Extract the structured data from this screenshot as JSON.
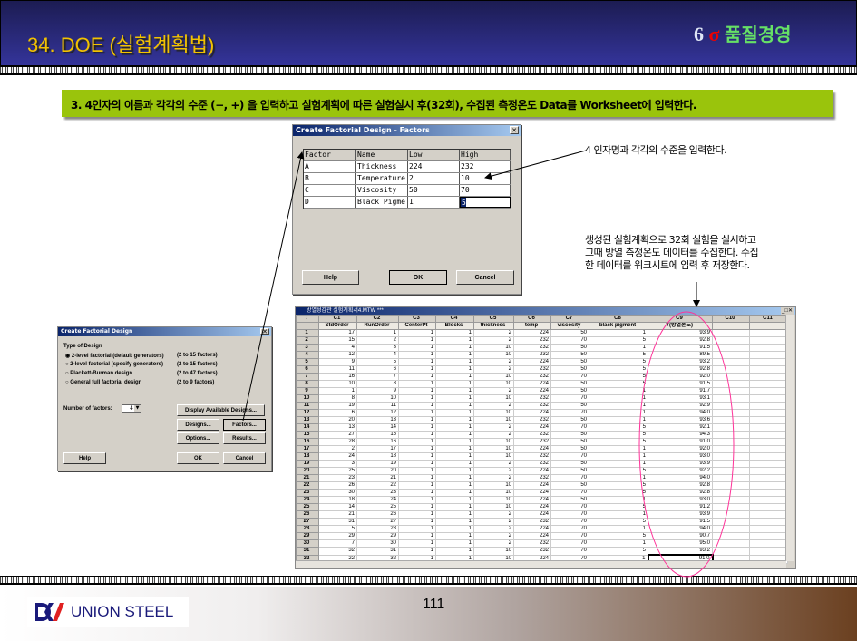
{
  "header": {
    "title": "34. DOE (실험계획법)",
    "brand_six": "6",
    "brand_sigma": "σ",
    "brand_text": "품질경영"
  },
  "banner": "3. 4인자의 이름과 각각의 수준 (−, +) 을 입력하고 실험계획에 따른 실험실시 후(32회), 수집된 측정온도 Data를 Worksheet에 입력한다.",
  "factors_dialog": {
    "title": "Create Factorial Design - Factors",
    "headers": [
      "Factor",
      "Name",
      "Low",
      "High"
    ],
    "rows": [
      [
        "A",
        "Thickness",
        "224",
        "232"
      ],
      [
        "B",
        "Temperature",
        "2",
        "10"
      ],
      [
        "C",
        "Viscosity",
        "50",
        "70"
      ],
      [
        "D",
        "Black Pigme",
        "1",
        "5"
      ]
    ],
    "help": "Help",
    "ok": "OK",
    "cancel": "Cancel"
  },
  "design_dialog": {
    "title": "Create Factorial Design",
    "type_label": "Type of Design",
    "options": [
      {
        "label": "2-level factorial (default generators)",
        "range": "(2 to 15 factors)"
      },
      {
        "label": "2-level factorial (specify generators)",
        "range": "(2 to 15 factors)"
      },
      {
        "label": "Plackett-Burman design",
        "range": "(2 to 47 factors)"
      },
      {
        "label": "General full factorial design",
        "range": "(2 to 9 factors)"
      }
    ],
    "num_factors_label": "Number of factors:",
    "num_factors": "4",
    "display_btn": "Display Available Designs...",
    "designs_btn": "Designs...",
    "factors_btn": "Factors...",
    "options_btn": "Options...",
    "results_btn": "Results...",
    "help": "Help",
    "ok": "OK",
    "cancel": "Cancel"
  },
  "notes": {
    "factor_note": "4 인자명과 각각의 수준을 입력한다.",
    "ws_note_1": "생성된 실험계획으로 32회 실험을 실시하고",
    "ws_note_2": "그때 방열 측정온도 데이터를 수집한다. 수집",
    "ws_note_3": "한 데이터를 워크시트에 입력 후 저장한다."
  },
  "worksheet": {
    "title": "방열성감관 실험계획서4.MTW ***",
    "col_ids": [
      "C1",
      "C2",
      "C3",
      "C4",
      "C5",
      "C6",
      "C7",
      "C8",
      "C9",
      "C10",
      "C11"
    ],
    "col_names": [
      "StdOrder",
      "RunOrder",
      "CenterPt",
      "Blocks",
      "thickness",
      "temp",
      "viscosity",
      "black pigment",
      "Y(방열온도)",
      "",
      ""
    ],
    "rows": [
      [
        17,
        1,
        1,
        1,
        2,
        224,
        50,
        1,
        "93.9"
      ],
      [
        15,
        2,
        1,
        1,
        2,
        232,
        70,
        5,
        "92.8"
      ],
      [
        4,
        3,
        1,
        1,
        10,
        232,
        50,
        1,
        "91.5"
      ],
      [
        12,
        4,
        1,
        1,
        10,
        232,
        50,
        5,
        "89.5"
      ],
      [
        9,
        5,
        1,
        1,
        2,
        224,
        50,
        5,
        "93.2"
      ],
      [
        11,
        6,
        1,
        1,
        2,
        232,
        50,
        5,
        "92.8"
      ],
      [
        16,
        7,
        1,
        1,
        10,
        232,
        70,
        5,
        "92.0"
      ],
      [
        10,
        8,
        1,
        1,
        10,
        224,
        50,
        5,
        "91.5"
      ],
      [
        1,
        9,
        1,
        1,
        2,
        224,
        50,
        1,
        "91.7"
      ],
      [
        8,
        10,
        1,
        1,
        10,
        232,
        70,
        1,
        "93.1"
      ],
      [
        19,
        11,
        1,
        1,
        2,
        232,
        50,
        1,
        "92.9"
      ],
      [
        6,
        12,
        1,
        1,
        10,
        224,
        70,
        1,
        "94.0"
      ],
      [
        20,
        13,
        1,
        1,
        10,
        232,
        50,
        1,
        "93.6"
      ],
      [
        13,
        14,
        1,
        1,
        2,
        224,
        70,
        5,
        "92.1"
      ],
      [
        27,
        15,
        1,
        1,
        2,
        232,
        50,
        5,
        "94.3"
      ],
      [
        28,
        16,
        1,
        1,
        10,
        232,
        50,
        5,
        "91.0"
      ],
      [
        2,
        17,
        1,
        1,
        10,
        224,
        50,
        1,
        "92.0"
      ],
      [
        24,
        18,
        1,
        1,
        10,
        232,
        70,
        1,
        "93.0"
      ],
      [
        3,
        19,
        1,
        1,
        2,
        232,
        50,
        1,
        "93.9"
      ],
      [
        25,
        20,
        1,
        1,
        2,
        224,
        50,
        5,
        "92.2"
      ],
      [
        23,
        21,
        1,
        1,
        2,
        232,
        70,
        1,
        "94.0"
      ],
      [
        26,
        22,
        1,
        1,
        10,
        224,
        50,
        5,
        "92.8"
      ],
      [
        30,
        23,
        1,
        1,
        10,
        224,
        70,
        5,
        "92.8"
      ],
      [
        18,
        24,
        1,
        1,
        10,
        224,
        50,
        1,
        "93.0"
      ],
      [
        14,
        25,
        1,
        1,
        10,
        224,
        70,
        5,
        "91.2"
      ],
      [
        21,
        26,
        1,
        1,
        2,
        224,
        70,
        1,
        "93.9"
      ],
      [
        31,
        27,
        1,
        1,
        2,
        232,
        70,
        5,
        "91.5"
      ],
      [
        5,
        28,
        1,
        1,
        2,
        224,
        70,
        1,
        "94.0"
      ],
      [
        29,
        29,
        1,
        1,
        2,
        224,
        70,
        5,
        "90.7"
      ],
      [
        7,
        30,
        1,
        1,
        2,
        232,
        70,
        1,
        "95.0"
      ],
      [
        32,
        31,
        1,
        1,
        10,
        232,
        70,
        5,
        "93.2"
      ],
      [
        22,
        32,
        1,
        1,
        10,
        224,
        70,
        1,
        "91.0"
      ]
    ]
  },
  "footer": {
    "company": "UNION STEEL",
    "page": "111"
  },
  "colors": {
    "banner": "#9ac40c",
    "highlight_ellipse": "#ff3399",
    "title": "#f2c200"
  }
}
